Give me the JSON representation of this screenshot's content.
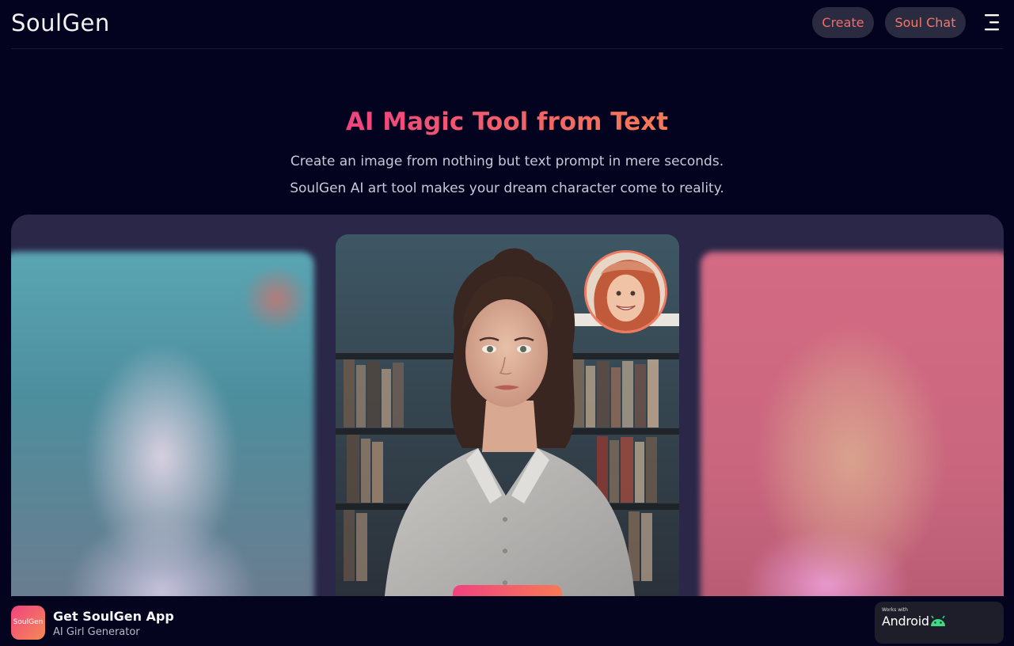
{
  "header": {
    "logo": "SoulGen",
    "nav": {
      "create_label": "Create",
      "soul_chat_label": "Soul Chat"
    },
    "menu_icon": "menu-icon"
  },
  "hero": {
    "title": "AI Magic Tool from Text",
    "subtitle_line1": "Create an image from nothing but text prompt in mere seconds.",
    "subtitle_line2": "SoulGen AI art tool makes your dream character come to reality."
  },
  "carousel": {
    "cards": [
      {
        "position": "left",
        "blurred": true
      },
      {
        "position": "center",
        "blurred": false,
        "has_avatar_inset": true
      },
      {
        "position": "right",
        "blurred": true
      }
    ]
  },
  "appbar": {
    "icon_text": "SoulGen",
    "title": "Get SoulGen App",
    "subtitle": "AI Girl Generator",
    "android_badge": {
      "small_text": "Works with",
      "label": "Android"
    }
  },
  "colors": {
    "background": "#03031f",
    "accent_start": "#f0437f",
    "accent_end": "#f57a55",
    "nav_button_bg": "#2a2a40",
    "panel_bg": "#2a2748",
    "android_green": "#3ddc84"
  }
}
